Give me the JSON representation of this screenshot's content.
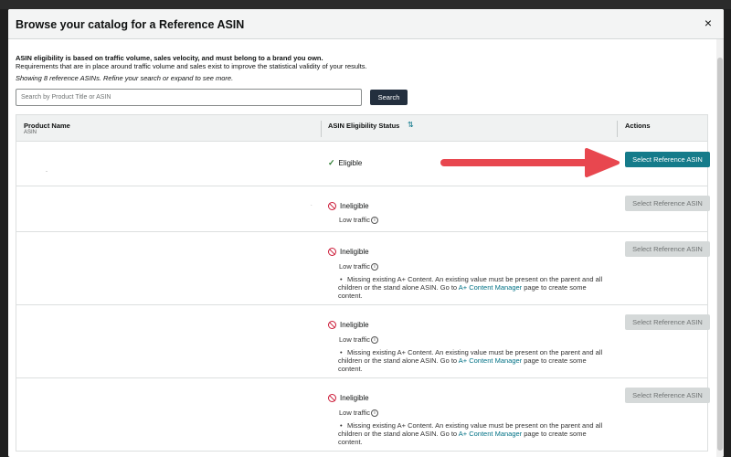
{
  "modal": {
    "title": "Browse your catalog for a Reference ASIN",
    "close": "×"
  },
  "intro": {
    "line1": "ASIN eligibility is based on traffic volume, sales velocity, and must belong to a brand you own.",
    "line2": "Requirements that are in place around traffic volume and sales exist to improve the statistical validity of your results.",
    "showing": "Showing 8 reference ASINs. Refine your search or expand to see more."
  },
  "search": {
    "placeholder": "Search by Product Title or ASIN",
    "button": "Search"
  },
  "table": {
    "headers": {
      "product": "Product Name",
      "product_sub": "ASIN",
      "status": "ASIN Eligibility Status",
      "actions": "Actions"
    },
    "rows": [
      {
        "status": "Eligible",
        "button": "Select Reference ASIN"
      },
      {
        "status": "Ineligible",
        "reason": "Low traffic",
        "button": "Select Reference ASIN"
      },
      {
        "status": "Ineligible",
        "reason": "Low traffic",
        "bullet_a": "Missing existing A+ Content. An existing value must be present on the parent and all children or the stand alone ASIN. Go to",
        "link": "A+ Content Manager",
        "bullet_b": "page to create some content.",
        "button": "Select Reference ASIN"
      },
      {
        "status": "Ineligible",
        "reason": "Low traffic",
        "bullet_a": "Missing existing A+ Content. An existing value must be present on the parent and all children or the stand alone ASIN. Go to",
        "link": "A+ Content Manager",
        "bullet_b": "page to create some content.",
        "button": "Select Reference ASIN"
      },
      {
        "status": "Ineligible",
        "reason": "Low traffic",
        "bullet_a": "Missing existing A+ Content. An existing value must be present on the parent and all children or the stand alone ASIN. Go to",
        "link": "A+ Content Manager",
        "bullet_b": "page to create some content.",
        "button": "Select Reference ASIN"
      }
    ]
  },
  "icons": {
    "eligible": "check-icon",
    "ineligible": "ban-icon",
    "info": "info-icon",
    "sort": "sort-icon",
    "arrow": "arrow-annotation"
  },
  "colors": {
    "accent": "#157b8a",
    "link": "#007185",
    "error": "#cc1c39",
    "success": "#2e7d32",
    "arrow": "#e8474f",
    "header_bg": "#232f3e"
  }
}
